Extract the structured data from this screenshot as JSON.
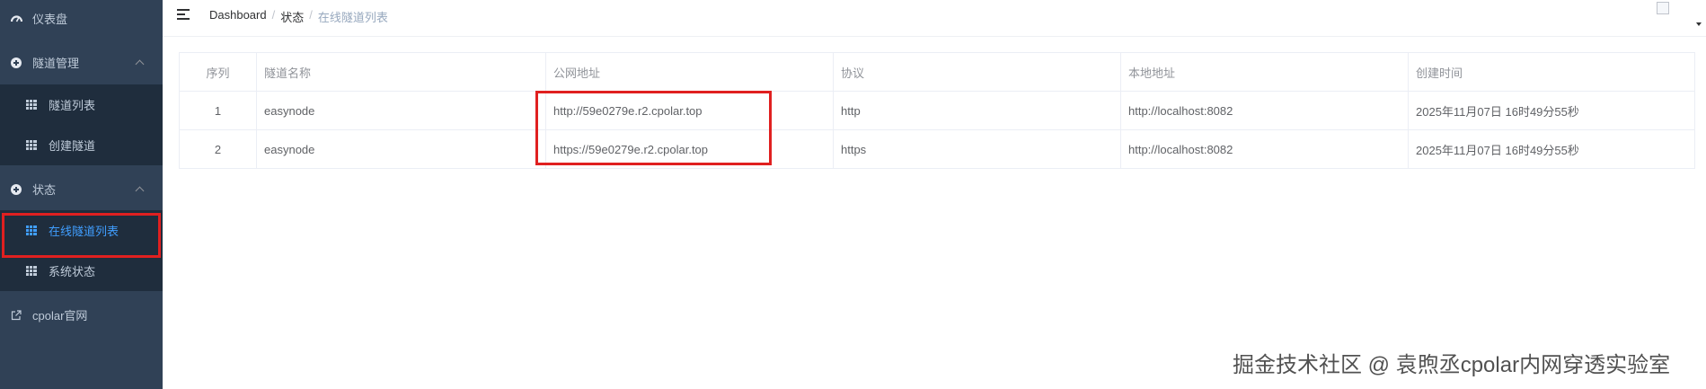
{
  "sidebar": {
    "items": [
      {
        "label": "仪表盘",
        "icon": "dashboard-icon"
      },
      {
        "label": "隧道管理",
        "icon": "plus-circle-icon"
      },
      {
        "label": "隧道列表",
        "icon": "table-icon"
      },
      {
        "label": "创建隧道",
        "icon": "table-icon"
      },
      {
        "label": "状态",
        "icon": "plus-circle-icon"
      },
      {
        "label": "在线隧道列表",
        "icon": "table-icon"
      },
      {
        "label": "系统状态",
        "icon": "table-icon"
      },
      {
        "label": "cpolar官网",
        "icon": "external-link-icon"
      }
    ],
    "active_color": "#409eff",
    "background": "#304156"
  },
  "breadcrumb": {
    "home": "Dashboard",
    "sep": "/",
    "parent": "状态",
    "current": "在线隧道列表"
  },
  "table": {
    "headers": [
      "序列",
      "隧道名称",
      "公网地址",
      "协议",
      "本地地址",
      "创建时间"
    ],
    "rows": [
      [
        "1",
        "easynode",
        "http://59e0279e.r2.cpolar.top",
        "http",
        "http://localhost:8082",
        "2025年11月07日 16时49分55秒"
      ],
      [
        "2",
        "easynode",
        "https://59e0279e.r2.cpolar.top",
        "https",
        "http://localhost:8082",
        "2025年11月07日 16时49分55秒"
      ]
    ]
  },
  "watermark": "掘金技术社区 @ 袁煦丞cpolar内网穿透实验室"
}
